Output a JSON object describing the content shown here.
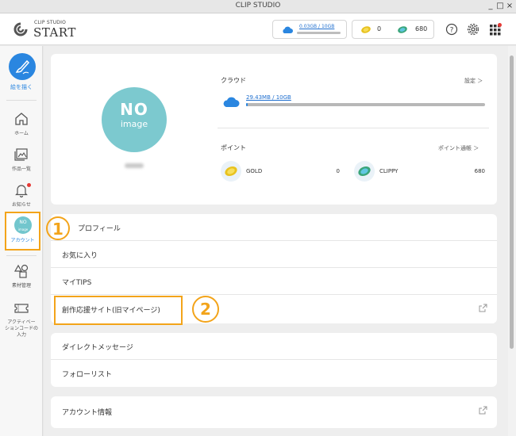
{
  "window": {
    "title": "CLIP STUDIO",
    "controls": [
      "_",
      "□",
      "×"
    ]
  },
  "header": {
    "logo_small": "CLIP STUDIO",
    "logo_big": "START",
    "storage_text": "0.03GB / 10GB",
    "gold_count": "0",
    "clippy_count": "680"
  },
  "nav": {
    "draw_label": "絵を描く",
    "home_label": "ホーム",
    "works_label": "作品一覧",
    "notice_label": "お知らせ",
    "account_avatar_line1": "NO",
    "account_avatar_line2": "image",
    "account_label": "アカウント",
    "materials_label": "素材管理",
    "activation_line1": "アクティベー",
    "activation_line2": "ションコードの",
    "activation_line3": "入力"
  },
  "profile": {
    "avatar_line1": "NO",
    "avatar_line2": "image",
    "cloud_title": "クラウド",
    "cloud_link": "設定 ＞",
    "cloud_storage": "29.43MB / 10GB",
    "cloud_usage_fraction": 0.003,
    "points_title": "ポイント",
    "points_link": "ポイント通帳 ＞",
    "gold_label": "GOLD",
    "gold_value": "0",
    "clippy_label": "CLIPPY",
    "clippy_value": "680"
  },
  "menu1": [
    "プロフィール",
    "お気に入り",
    "マイTIPS",
    "創作応援サイト(旧マイページ)"
  ],
  "menu2": [
    "ダイレクトメッセージ",
    "フォローリスト"
  ],
  "menu3": [
    "アカウント情報"
  ],
  "callouts": {
    "one": "1",
    "two": "2"
  },
  "colors": {
    "accent": "#2a86e0",
    "highlight": "#f3a41a",
    "avatar": "#7cc9cf"
  }
}
